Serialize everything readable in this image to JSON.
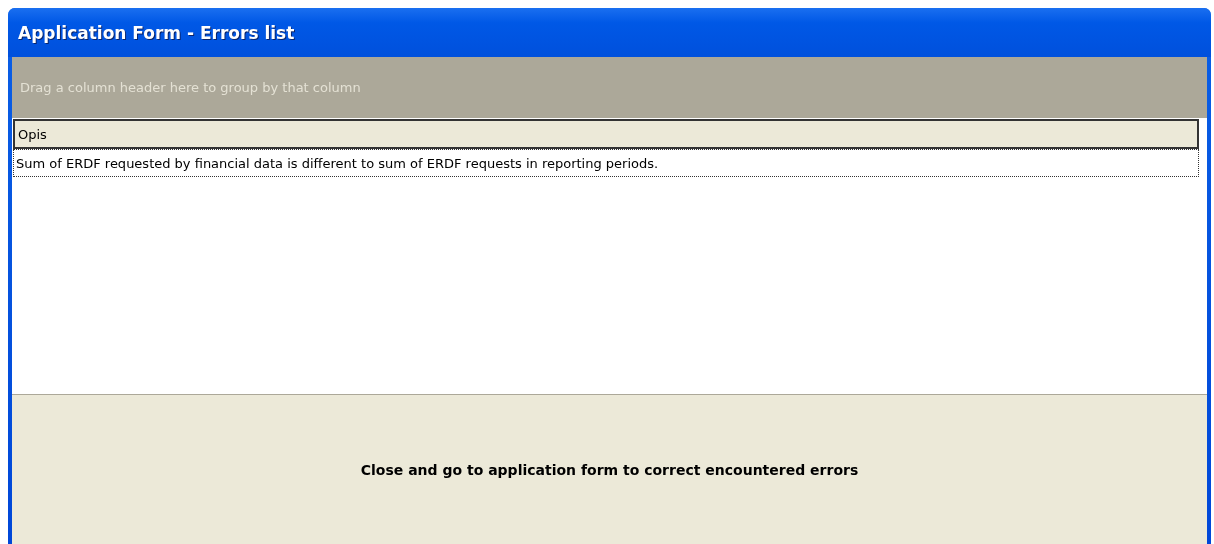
{
  "window": {
    "title": "Application Form - Errors list"
  },
  "group_panel": {
    "placeholder": "Drag a column header here to group by that column"
  },
  "table": {
    "columns": [
      "Opis"
    ],
    "rows": [
      {
        "cells": [
          "Sum of ERDF requested by financial data is different to sum of ERDF requests in reporting periods."
        ],
        "selected": true
      }
    ]
  },
  "button": {
    "label": "Close and go to application form to correct encountered errors"
  }
}
